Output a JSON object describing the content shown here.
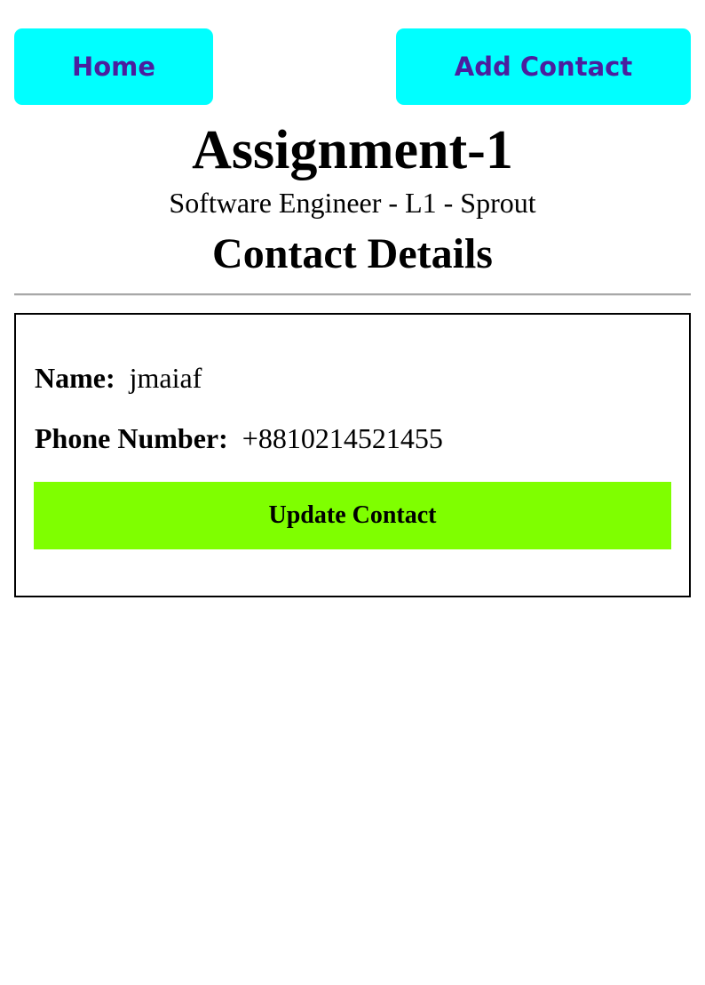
{
  "nav": {
    "home_label": "Home",
    "add_contact_label": "Add Contact"
  },
  "header": {
    "title": "Assignment-1",
    "subtitle": "Software Engineer - L1 - Sprout",
    "section_title": "Contact Details"
  },
  "contact": {
    "name_label": "Name:",
    "name_value": "jmaiaf",
    "phone_label": "Phone Number:",
    "phone_value": "+8810214521455",
    "update_label": "Update Contact"
  },
  "colors": {
    "nav_button_bg": "#00ffff",
    "nav_button_text": "#4b1f9e",
    "update_button_bg": "#7fff00",
    "divider": "#a8a8a8"
  }
}
